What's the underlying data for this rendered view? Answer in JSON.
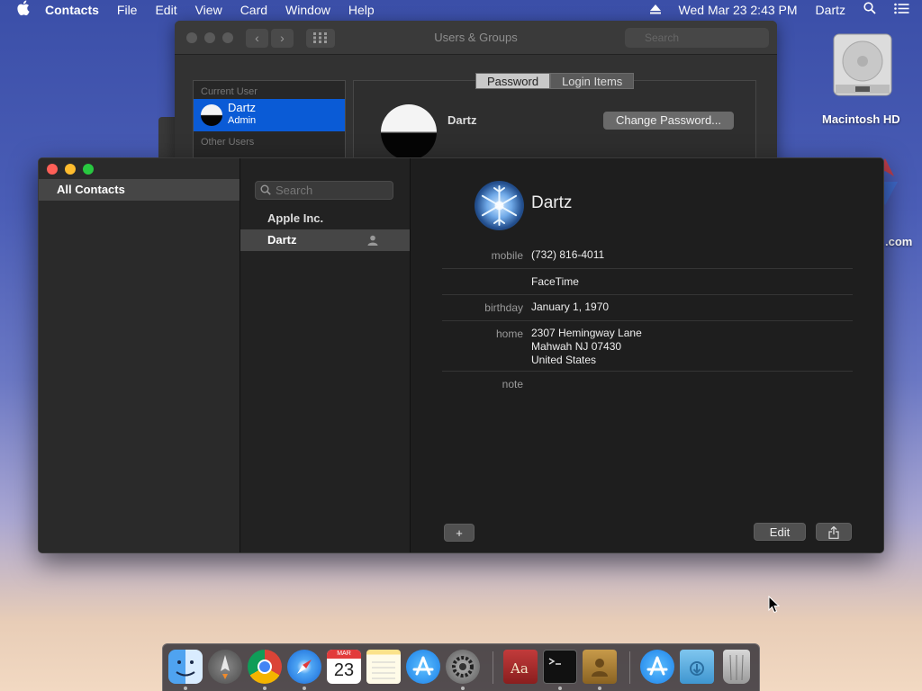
{
  "menubar": {
    "app": "Contacts",
    "menus": [
      "File",
      "Edit",
      "View",
      "Card",
      "Window",
      "Help"
    ],
    "datetime": "Wed Mar 23  2:43 PM",
    "user": "Dartz"
  },
  "users_groups": {
    "title": "Users & Groups",
    "search_placeholder": "Search",
    "current_user_header": "Current User",
    "current_user_name": "Dartz",
    "current_user_role": "Admin",
    "other_users_header": "Other Users",
    "tabs": [
      "Password",
      "Login Items"
    ],
    "active_tab": "Password",
    "user_name": "Dartz",
    "change_password_label": "Change Password..."
  },
  "contacts": {
    "group": "All Contacts",
    "search_placeholder": "Search",
    "list": [
      {
        "name": "Apple Inc.",
        "selected": false
      },
      {
        "name": "Dartz",
        "selected": true
      }
    ],
    "card": {
      "name": "Dartz",
      "mobile_label": "mobile",
      "mobile": "(732) 816-4011",
      "facetime": "FaceTime",
      "birthday_label": "birthday",
      "birthday": "January 1, 1970",
      "home_label": "home",
      "address_line1": "2307 Hemingway Lane",
      "address_line2": "Mahwah NJ 07430",
      "address_line3": "United States",
      "note_label": "note"
    },
    "add_label": "+",
    "edit_label": "Edit"
  },
  "desktop": {
    "drive_label": "Macintosh HD",
    "partial_label": ".com"
  },
  "dock": {
    "calendar_month": "MAR",
    "calendar_day": "23"
  },
  "colors": {
    "accent": "#0a5bd6",
    "close": "#fe5f57",
    "minimize": "#febc2e",
    "zoom": "#28c840"
  }
}
